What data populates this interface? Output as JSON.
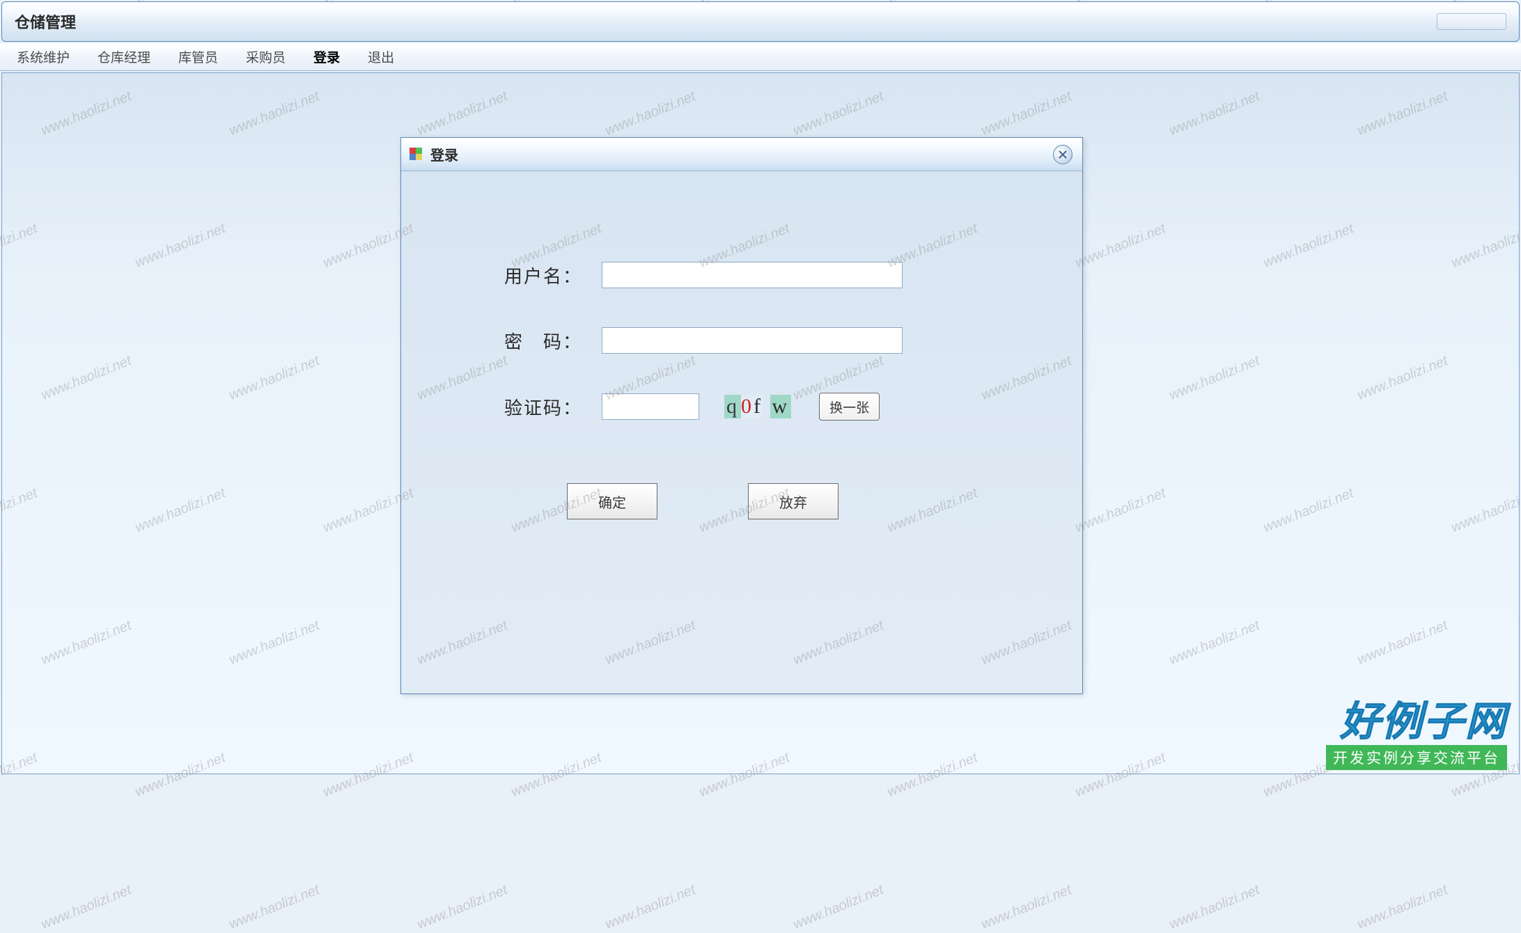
{
  "app": {
    "title": "仓储管理"
  },
  "menu": {
    "items": [
      "系统维护",
      "仓库经理",
      "库管员",
      "采购员",
      "登录",
      "退出"
    ],
    "active_index": 4
  },
  "dialog": {
    "title": "登录",
    "labels": {
      "username": "用户名：",
      "password": "密　码：",
      "captcha": "验证码："
    },
    "values": {
      "username": "",
      "password": "",
      "captcha": ""
    },
    "captcha_chars": [
      "q",
      "0",
      "f",
      "w"
    ],
    "buttons": {
      "refresh": "换一张",
      "ok": "确定",
      "cancel": "放弃"
    }
  },
  "watermark": {
    "text": "www.haolizi.net"
  },
  "brand": {
    "main": "好例子网",
    "sub": "开发实例分享交流平台"
  }
}
